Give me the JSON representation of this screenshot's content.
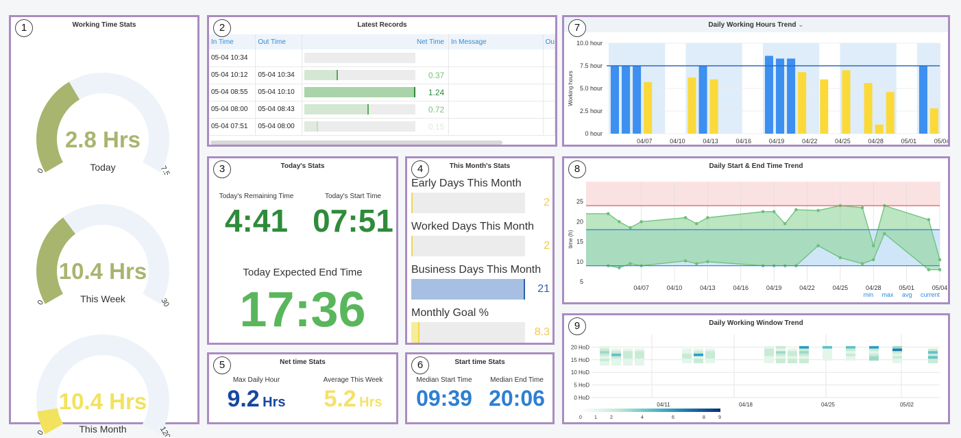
{
  "colors": {
    "olive": "#a8b56e",
    "yellow": "#f2e25d",
    "green_dark": "#2e8b3a",
    "green": "#5ab65c",
    "blue_dark": "#1548a3",
    "blue": "#2e7fd1",
    "track": "#edf3f9",
    "bar_blue": "#3d8ff0",
    "bar_yellow": "#fbd93a",
    "shade": "#d6e9f8"
  },
  "panel1": {
    "badge": "1",
    "title": "Working Time Stats",
    "gauges": [
      {
        "value_text": "2.8 Hrs",
        "label": "Today",
        "min": "0",
        "max": "7.5",
        "fraction": 0.373,
        "color": "#a8b56e"
      },
      {
        "value_text": "10.4 Hrs",
        "label": "This Week",
        "min": "0",
        "max": "30",
        "fraction": 0.347,
        "color": "#a8b56e"
      },
      {
        "value_text": "10.4 Hrs",
        "label": "This Month",
        "min": "0",
        "max": "120",
        "fraction": 0.087,
        "color": "#f2e25d"
      }
    ]
  },
  "panel2": {
    "badge": "2",
    "title": "Latest Records",
    "columns": [
      "In Time",
      "Out Time",
      "Net Time",
      "In Message",
      "Ou"
    ],
    "rows": [
      {
        "in": "05-04 10:34",
        "out": "",
        "net": "",
        "fraction": 0
      },
      {
        "in": "05-04 10:12",
        "out": "05-04 10:34",
        "net": "0.37",
        "fraction": 0.3
      },
      {
        "in": "05-04 08:55",
        "out": "05-04 10:10",
        "net": "1.24",
        "fraction": 1.0
      },
      {
        "in": "05-04 08:00",
        "out": "05-04 08:43",
        "net": "0.72",
        "fraction": 0.58
      },
      {
        "in": "05-04 07:51",
        "out": "05-04 08:00",
        "net": "0.15",
        "fraction": 0.12
      }
    ]
  },
  "panel3": {
    "badge": "3",
    "title": "Today's Stats",
    "remaining_label": "Today's Remaining Time",
    "remaining_value": "4:41",
    "start_label": "Today's Start Time",
    "start_value": "07:51",
    "end_label": "Today Expected End Time",
    "end_value": "17:36"
  },
  "panel4": {
    "badge": "4",
    "title": "This Month's Stats",
    "items": [
      {
        "label": "Early Days This Month",
        "value": "2",
        "fraction": 0.01,
        "color": "#f2e25d",
        "value_color": "#f2c94c"
      },
      {
        "label": "Worked Days This Month",
        "value": "2",
        "fraction": 0.01,
        "color": "#f2e25d",
        "value_color": "#f2c94c"
      },
      {
        "label": "Business Days This Month",
        "value": "21",
        "fraction": 1.0,
        "color": "#a6bfe3",
        "value_color": "#2e5fa8"
      },
      {
        "label": "Monthly Goal %",
        "value": "8.3",
        "fraction": 0.07,
        "color": "#f6ec9c",
        "value_color": "#f2c94c"
      }
    ]
  },
  "panel5": {
    "badge": "5",
    "title": "Net time Stats",
    "max_label": "Max Daily Hour",
    "max_value": "9.2",
    "max_unit": "Hrs",
    "avg_label": "Average This Week",
    "avg_value": "5.2",
    "avg_unit": "Hrs"
  },
  "panel6": {
    "badge": "6",
    "title": "Start time Stats",
    "start_label": "Median Start Time",
    "start_value": "09:39",
    "end_label": "Median End Time",
    "end_value": "20:06"
  },
  "panel7": {
    "badge": "7",
    "title": "Daily Working Hours Trend",
    "ylabel": "Working hours"
  },
  "panel8": {
    "badge": "8",
    "title": "Daily Start & End Time Trend",
    "ylabel": "time (h)",
    "legend": [
      "min",
      "max",
      "avg",
      "current"
    ]
  },
  "panel9": {
    "badge": "9",
    "title": "Daily Working Window Trend",
    "scale_ticks": [
      "0",
      "1",
      "2",
      "4",
      "6",
      "8",
      "9"
    ]
  },
  "chart_data": [
    {
      "type": "bar",
      "title": "Daily Working Hours Trend",
      "ylabel": "Working hours",
      "y_ticks": [
        "0 hour",
        "2.5 hour",
        "5.0 hour",
        "7.5 hour",
        "10.0 hour"
      ],
      "ylim": [
        0,
        10
      ],
      "x_ticks": [
        "04/07",
        "04/10",
        "04/13",
        "04/16",
        "04/19",
        "04/22",
        "04/25",
        "04/28",
        "05/01",
        "05/04"
      ],
      "x_range_days": [
        0,
        30
      ],
      "target_line": 7.5,
      "bars": [
        {
          "day": 0,
          "value": 7.5,
          "series": "blue"
        },
        {
          "day": 1,
          "value": 7.5,
          "series": "blue"
        },
        {
          "day": 2,
          "value": 7.5,
          "series": "blue"
        },
        {
          "day": 3,
          "value": 5.7,
          "series": "yellow"
        },
        {
          "day": 7,
          "value": 6.2,
          "series": "yellow"
        },
        {
          "day": 8,
          "value": 7.5,
          "series": "blue"
        },
        {
          "day": 9,
          "value": 6.0,
          "series": "yellow"
        },
        {
          "day": 14,
          "value": 8.6,
          "series": "blue"
        },
        {
          "day": 15,
          "value": 8.3,
          "series": "blue"
        },
        {
          "day": 16,
          "value": 8.3,
          "series": "blue"
        },
        {
          "day": 17,
          "value": 6.8,
          "series": "yellow"
        },
        {
          "day": 19,
          "value": 6.0,
          "series": "yellow"
        },
        {
          "day": 21,
          "value": 7.0,
          "series": "yellow"
        },
        {
          "day": 23,
          "value": 5.6,
          "series": "yellow"
        },
        {
          "day": 24,
          "value": 1.0,
          "series": "yellow"
        },
        {
          "day": 25,
          "value": 4.6,
          "series": "yellow"
        },
        {
          "day": 28,
          "value": 7.5,
          "series": "blue"
        },
        {
          "day": 29,
          "value": 2.8,
          "series": "yellow"
        }
      ],
      "shaded_weeks": [
        [
          0,
          4
        ],
        [
          7,
          11
        ],
        [
          14,
          18
        ],
        [
          21,
          25
        ],
        [
          28,
          29
        ]
      ]
    },
    {
      "type": "area",
      "title": "Daily Start & End Time Trend",
      "ylabel": "time (h)",
      "y_ticks": [
        "5",
        "10",
        "15",
        "20",
        "25"
      ],
      "ylim": [
        5,
        30
      ],
      "x_ticks": [
        "04/07",
        "04/10",
        "04/13",
        "04/16",
        "04/19",
        "04/22",
        "04/25",
        "04/28",
        "05/01",
        "05/04"
      ],
      "thresholds": {
        "red_band": [
          24,
          30
        ],
        "red_line": 24,
        "blue_band": [
          9,
          18
        ],
        "blue_lines": [
          9,
          18
        ]
      },
      "series": [
        {
          "name": "end",
          "points": [
            [
              -2,
              22
            ],
            [
              0,
              22
            ],
            [
              1,
              20
            ],
            [
              2,
              18.5
            ],
            [
              3,
              20
            ],
            [
              7,
              21
            ],
            [
              8,
              19.5
            ],
            [
              9,
              21
            ],
            [
              14,
              22.5
            ],
            [
              15,
              22.5
            ],
            [
              16,
              19.5
            ],
            [
              17,
              23
            ],
            [
              19,
              22.8
            ],
            [
              21,
              24
            ],
            [
              23,
              23.5
            ],
            [
              24,
              14
            ],
            [
              25,
              24
            ],
            [
              29,
              20.5
            ],
            [
              30,
              10.5
            ]
          ]
        },
        {
          "name": "start",
          "points": [
            [
              -2,
              9
            ],
            [
              0,
              9
            ],
            [
              1,
              8.5
            ],
            [
              2,
              9.5
            ],
            [
              3,
              9
            ],
            [
              7,
              10.2
            ],
            [
              8,
              9.5
            ],
            [
              9,
              10
            ],
            [
              14,
              9
            ],
            [
              15,
              9
            ],
            [
              16,
              9
            ],
            [
              17,
              9
            ],
            [
              19,
              14
            ],
            [
              21,
              11
            ],
            [
              23,
              9.5
            ],
            [
              24,
              10.5
            ],
            [
              25,
              17
            ],
            [
              29,
              8
            ],
            [
              30,
              8
            ]
          ]
        }
      ]
    },
    {
      "type": "heatmap",
      "title": "Daily Working Window Trend",
      "y_ticks": [
        "0 HoD",
        "5 HoD",
        "10 HoD",
        "15 HoD",
        "20 HoD"
      ],
      "x_ticks": [
        "04/11",
        "04/18",
        "04/25",
        "05/02"
      ],
      "scale": [
        0,
        9
      ]
    }
  ]
}
